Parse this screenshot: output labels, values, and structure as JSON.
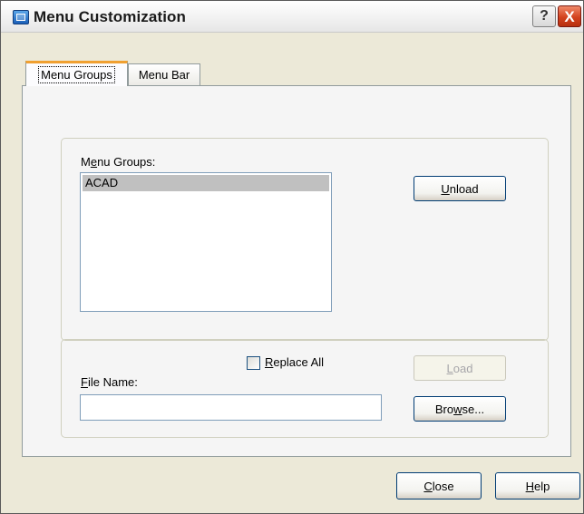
{
  "window": {
    "title": "Menu Customization",
    "help_symbol": "?",
    "close_symbol": "X"
  },
  "tabs": [
    {
      "label": "Menu Groups",
      "selected": true
    },
    {
      "label": "Menu Bar",
      "selected": false
    }
  ],
  "menu_groups": {
    "label_prefix": "M",
    "label_accel": "e",
    "label_suffix": "nu Groups:",
    "items": [
      "ACAD"
    ],
    "selected_item": "ACAD"
  },
  "unload_button": {
    "accel": "U",
    "rest": "nload"
  },
  "replace_all": {
    "accel": "R",
    "rest": "eplace All",
    "checked": false
  },
  "file_name": {
    "accel": "F",
    "rest": "ile Name:",
    "value": ""
  },
  "load_button": {
    "accel": "L",
    "rest": "oad",
    "enabled": false
  },
  "browse_button": {
    "prefix": "Bro",
    "accel": "w",
    "rest": "se..."
  },
  "close_button": {
    "accel": "C",
    "rest": "lose"
  },
  "help_button": {
    "accel": "H",
    "rest": "elp"
  },
  "colors": {
    "dialog_bg": "#ece9d8",
    "panel_bg": "#f5f5f5",
    "selection": "#c0c0c0",
    "active_tab_accent": "#f0a030",
    "close_red": "#d3421e",
    "button_border": "#003c74"
  },
  "icons": [
    "app-icon",
    "help-icon",
    "close-icon"
  ]
}
